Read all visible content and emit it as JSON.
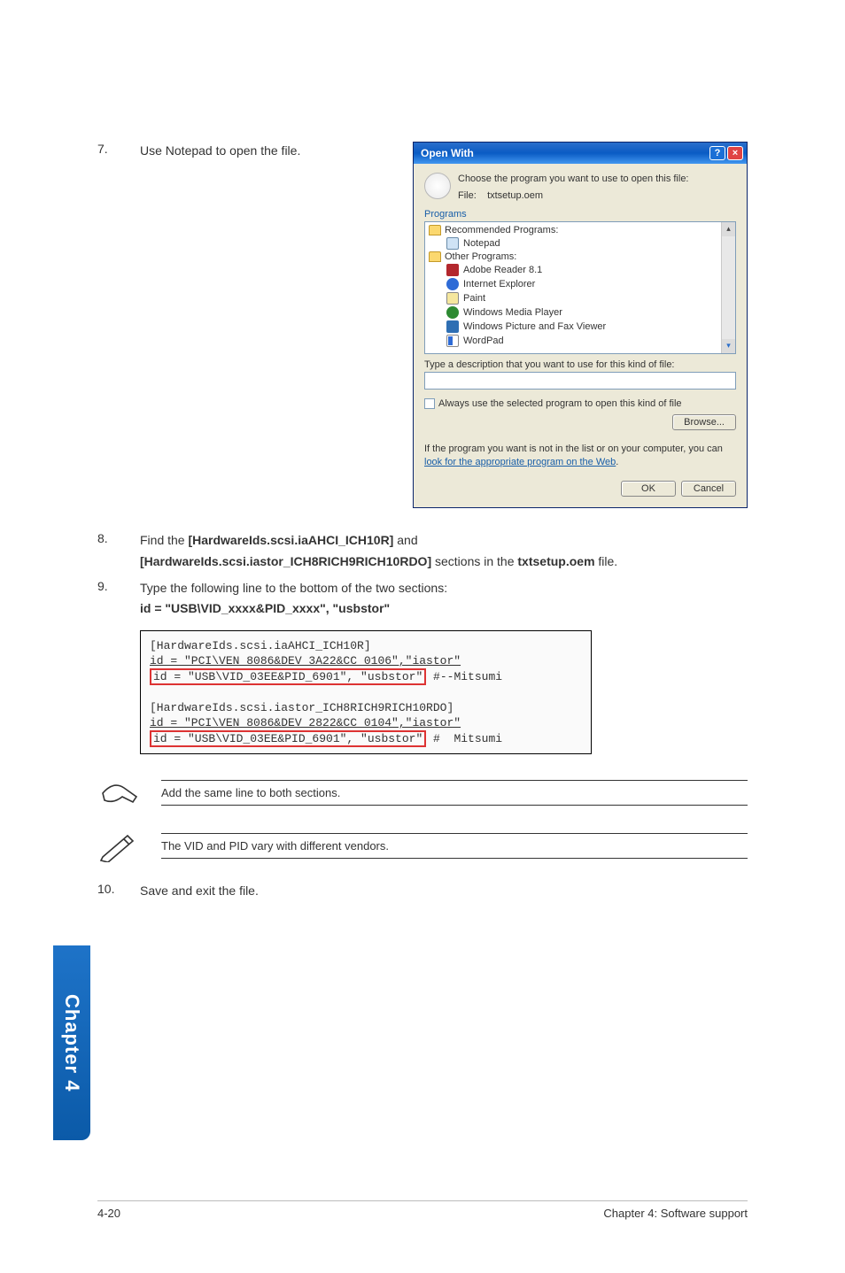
{
  "steps": {
    "s7": {
      "num": "7.",
      "text": "Use Notepad to open the file."
    },
    "s8": {
      "num": "8.",
      "part1": "Find the ",
      "b1": "[HardwareIds.scsi.iaAHCI_ICH10R]",
      "part2": " and",
      "line2_b": "[HardwareIds.scsi.iastor_ICH8RICH9RICH10RDO]",
      "line2_mid": " sections in the ",
      "line2_b2": "txtsetup.oem",
      "line2_end": " file."
    },
    "s9": {
      "num": "9.",
      "line1": "Type the following line to the bottom of the two sections:",
      "line2": "id = \"USB\\VID_xxxx&PID_xxxx\", \"usbstor\""
    },
    "s10": {
      "num": "10.",
      "text": "Save and exit the file."
    }
  },
  "dialog": {
    "title": "Open With",
    "help": "?",
    "close": "×",
    "choose": "Choose the program you want to use to open this file:",
    "fileLabel": "File:",
    "fileName": "txtsetup.oem",
    "programsHeader": "Programs",
    "recommended": "Recommended Programs:",
    "notepad": "Notepad",
    "other": "Other Programs:",
    "adobe": "Adobe Reader 8.1",
    "ie": "Internet Explorer",
    "paint": "Paint",
    "wmp": "Windows Media Player",
    "fax": "Windows Picture and Fax Viewer",
    "wordpad": "WordPad",
    "desc": "Type a description that you want to use for this kind of file:",
    "always": "Always use the selected program to open this kind of file",
    "browse": "Browse...",
    "notePart1": "If the program you want is not in the list or on your computer, you can ",
    "noteLink": "look for the appropriate program on the Web",
    "notePart2": ".",
    "ok": "OK",
    "cancel": "Cancel"
  },
  "code": {
    "l1": "[HardwareIds.scsi.iaAHCI_ICH10R]",
    "l2a": "id = \"PCI\\VEN_8086&DEV_3A22&CC_0106\",\"iastor\"",
    "l3a": "id = \"USB\\VID_03EE&PID_6901\", \"usbstor\"",
    "l3b": " #--Mitsumi",
    "l4": "[HardwareIds.scsi.iastor_ICH8RICH9RICH10RDO]",
    "l5a": "id = \"PCI\\VEN_8086&DEV_2822&CC_0104\",\"iastor\"",
    "l6a": "id = \"USB\\VID_03EE&PID_6901\", \"usbstor\"",
    "l6b": " #  Mitsumi"
  },
  "notes": {
    "n1": "Add the same line to both sections.",
    "n2": "The VID and PID vary with different vendors."
  },
  "sideTab": "Chapter 4",
  "footer": {
    "left": "4-20",
    "right": "Chapter 4: Software support"
  }
}
